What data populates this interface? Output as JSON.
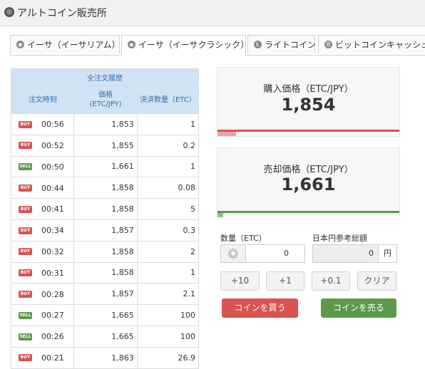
{
  "header": {
    "title": "アルトコイン販売所"
  },
  "tabs": [
    {
      "label": "イーサ（イーサリアム）",
      "active": false
    },
    {
      "label": "イーサ（イーサクラシック）",
      "active": true
    },
    {
      "label": "ライトコイン",
      "active": false
    },
    {
      "label": "ビットコインキャッシュ",
      "active": false
    }
  ],
  "history": {
    "title": "全注文履歴",
    "col_time": "注文時刻",
    "col_price_line1": "価格",
    "col_price_line2": "(ETC/JPY)",
    "col_qty": "決済数量（ETC）",
    "rows": [
      {
        "side": "BUY",
        "time": "00:56",
        "price": "1,853",
        "qty": "1"
      },
      {
        "side": "BUY",
        "time": "00:52",
        "price": "1,855",
        "qty": "0.2"
      },
      {
        "side": "SELL",
        "time": "00:50",
        "price": "1,661",
        "qty": "1"
      },
      {
        "side": "BUY",
        "time": "00:44",
        "price": "1,858",
        "qty": "0.08"
      },
      {
        "side": "BUY",
        "time": "00:41",
        "price": "1,858",
        "qty": "5"
      },
      {
        "side": "BUY",
        "time": "00:34",
        "price": "1,857",
        "qty": "0.3"
      },
      {
        "side": "BUY",
        "time": "00:32",
        "price": "1,858",
        "qty": "2"
      },
      {
        "side": "BUY",
        "time": "00:31",
        "price": "1,858",
        "qty": "1"
      },
      {
        "side": "BUY",
        "time": "00:28",
        "price": "1,857",
        "qty": "2.1"
      },
      {
        "side": "SELL",
        "time": "00:27",
        "price": "1,665",
        "qty": "100"
      },
      {
        "side": "SELL",
        "time": "00:26",
        "price": "1,665",
        "qty": "100"
      },
      {
        "side": "BUY",
        "time": "00:21",
        "price": "1,863",
        "qty": "26.9"
      }
    ]
  },
  "buy_price": {
    "label": "購入価格（ETC/JPY）",
    "value": "1,854",
    "color": "#d9534f",
    "fill_fraction": 0.1
  },
  "sell_price": {
    "label": "売却価格（ETC/JPY）",
    "value": "1,661",
    "color": "#5b9a48",
    "fill_fraction": 0.03
  },
  "form": {
    "qty_label": "数量（ETC）",
    "qty_value": "0",
    "yen_label": "日本円参考総額",
    "yen_value": "0",
    "yen_unit": "円"
  },
  "step_buttons": [
    "+10",
    "+1",
    "+0.1",
    "クリア"
  ],
  "actions": {
    "buy_label": "コインを買う",
    "sell_label": "コインを売る",
    "buy_color": "#d9534f",
    "sell_color": "#5b9a48"
  }
}
